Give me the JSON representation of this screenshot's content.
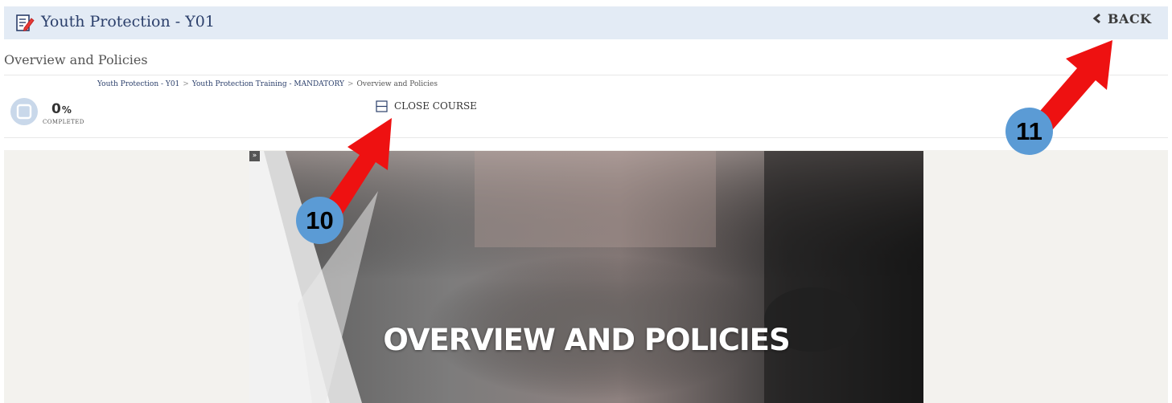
{
  "header": {
    "title": "Youth Protection - Y01",
    "back_label": "BACK",
    "edit_icon": "edit-note-icon",
    "back_icon": "chevron-left-icon"
  },
  "subtitle": "Overview and Policies",
  "breadcrumb": {
    "items": [
      "Youth Protection - Y01",
      "Youth Protection Training - MANDATORY",
      "Overview and Policies"
    ],
    "separator": ">"
  },
  "progress": {
    "value": "0",
    "unit": "%",
    "label": "COMPLETED",
    "fraction": 0
  },
  "close_course": {
    "label": "CLOSE COURSE",
    "icon": "close-course-icon"
  },
  "sidebar_toggle": "»",
  "hero": {
    "title": "OVERVIEW AND POLICIES"
  },
  "annotations": {
    "callout_10": "10",
    "callout_11": "11",
    "arrow_color": "#ee1111",
    "badge_color": "#5b9bd5"
  },
  "colors": {
    "header_bg": "#e3ebf5",
    "title_blue": "#2b3f6b",
    "content_bg": "#f3f2ee"
  }
}
